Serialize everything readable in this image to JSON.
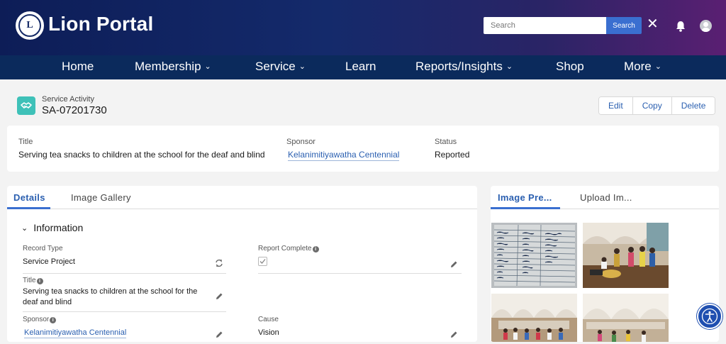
{
  "header": {
    "brand": "Lion Portal",
    "logo_text": "LIONS",
    "search_placeholder": "Search",
    "search_button": "Search"
  },
  "nav": {
    "items": [
      {
        "label": "Home",
        "dropdown": false
      },
      {
        "label": "Membership",
        "dropdown": true
      },
      {
        "label": "Service",
        "dropdown": true
      },
      {
        "label": "Learn",
        "dropdown": false
      },
      {
        "label": "Reports/Insights",
        "dropdown": true
      },
      {
        "label": "Shop",
        "dropdown": false
      },
      {
        "label": "More",
        "dropdown": true
      }
    ]
  },
  "record": {
    "type": "Service Activity",
    "name": "SA-07201730",
    "actions": [
      "Edit",
      "Copy",
      "Delete"
    ]
  },
  "highlights": {
    "title_label": "Title",
    "title_value": "Serving tea snacks to children at the school for the deaf and blind",
    "sponsor_label": "Sponsor",
    "sponsor_value": "Kelanimitiyawatha Centennial",
    "status_label": "Status",
    "status_value": "Reported"
  },
  "main_tabs": {
    "details": "Details",
    "image_gallery": "Image Gallery"
  },
  "information": {
    "section_title": "Information",
    "record_type_label": "Record Type",
    "record_type_value": "Service Project",
    "report_complete_label": "Report Complete",
    "report_complete_checked": true,
    "title_label": "Title",
    "title_value": "Serving tea snacks to children at the school for the deaf and blind",
    "sponsor_label": "Sponsor",
    "sponsor_value": "Kelanimitiyawatha Centennial",
    "cause_label": "Cause",
    "cause_value": "Vision"
  },
  "side_tabs": {
    "image_preview": "Image Pre...",
    "upload_image": "Upload Im..."
  },
  "colors": {
    "nav_bg": "#0b2a5c",
    "accent": "#3a6fd0",
    "link": "#2a5fb0",
    "record_icon": "#3ec1b8"
  }
}
